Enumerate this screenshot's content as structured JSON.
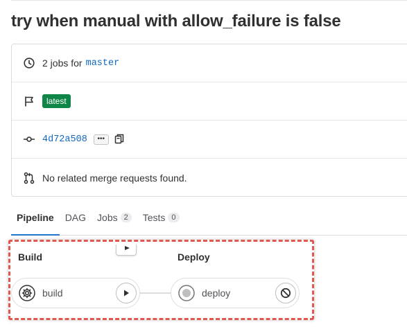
{
  "page": {
    "title": "try when manual with allow_failure is false"
  },
  "info": {
    "jobs_text": "2 jobs for",
    "branch": "master",
    "badge": "latest",
    "commit_sha": "4d72a508",
    "ellipsis": "•••",
    "merge_text": "No related merge requests found."
  },
  "tabs": [
    {
      "label": "Pipeline",
      "active": true
    },
    {
      "label": "DAG"
    },
    {
      "label": "Jobs",
      "count": "2"
    },
    {
      "label": "Tests",
      "count": "0"
    }
  ],
  "pipeline": {
    "stages": [
      {
        "title": "Build",
        "job": {
          "name": "build",
          "status_icon": "gear-icon",
          "action_icon": "play-icon"
        }
      },
      {
        "title": "Deploy",
        "job": {
          "name": "deploy",
          "status_icon": "skipped-circle-icon",
          "action_icon": "cancel-icon"
        }
      }
    ]
  },
  "colors": {
    "badge_green": "#108548",
    "link_blue": "#1068bf",
    "highlight_red": "#e0584f"
  }
}
